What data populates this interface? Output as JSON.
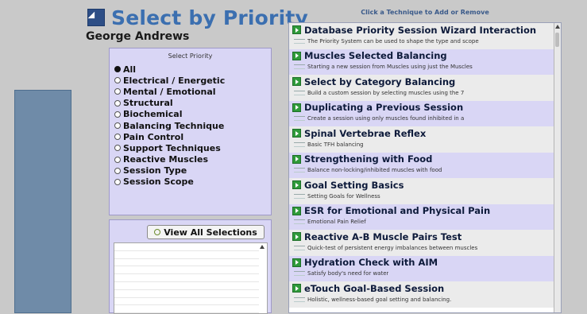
{
  "header": {
    "title": "Select by Priority",
    "user_name": "George Andrews"
  },
  "priority": {
    "label": "Select Priority",
    "selected_index": 0,
    "options": [
      "All",
      "Electrical / Energetic",
      "Mental / Emotional",
      "Structural",
      "Biochemical",
      "Balancing Technique",
      "Pain Control",
      "Support Techniques",
      "Reactive Muscles",
      "Session Type",
      "Session Scope"
    ]
  },
  "selections": {
    "view_all_label": "View All Selections"
  },
  "techniques": {
    "header": "Click a Technique to Add or Remove",
    "items": [
      {
        "title": "Database Priority Session Wizard Interaction",
        "desc": "The Priority System can be used to shape the type and scope"
      },
      {
        "title": "Muscles Selected Balancing",
        "desc": "Starting a new session from Muscles using just the Muscles"
      },
      {
        "title": "Select by Category Balancing",
        "desc": "Build a custom session by selecting muscles using the 7"
      },
      {
        "title": "Duplicating a Previous Session",
        "desc": "Create a session using only muscles found inhibited in a"
      },
      {
        "title": "Spinal Vertebrae Reflex",
        "desc": "Basic TFH balancing"
      },
      {
        "title": "Strengthening with Food",
        "desc": "Balance non-locking/inhibited muscles with food"
      },
      {
        "title": "Goal Setting Basics",
        "desc": "Setting Goals for Wellness"
      },
      {
        "title": "ESR for Emotional and Physical Pain",
        "desc": "Emotional Pain Relief"
      },
      {
        "title": "Reactive A-B Muscle Pairs Test",
        "desc": "Quick-test of persistent energy imbalances between muscles"
      },
      {
        "title": "Hydration Check with AIM",
        "desc": "Satisfy body's need for water"
      },
      {
        "title": "eTouch Goal-Based Session",
        "desc": "Holistic, wellness-based goal setting and balancing."
      }
    ]
  },
  "colors": {
    "title": "#3b6fb0",
    "panel_purple": "#d9d6f5",
    "panel_gray": "#ebebeb",
    "add_icon_green": "#2f9a3a"
  },
  "icons": {
    "title": "priority-logo-icon",
    "add": "add-technique-icon",
    "view_all": "view-all-icon"
  }
}
